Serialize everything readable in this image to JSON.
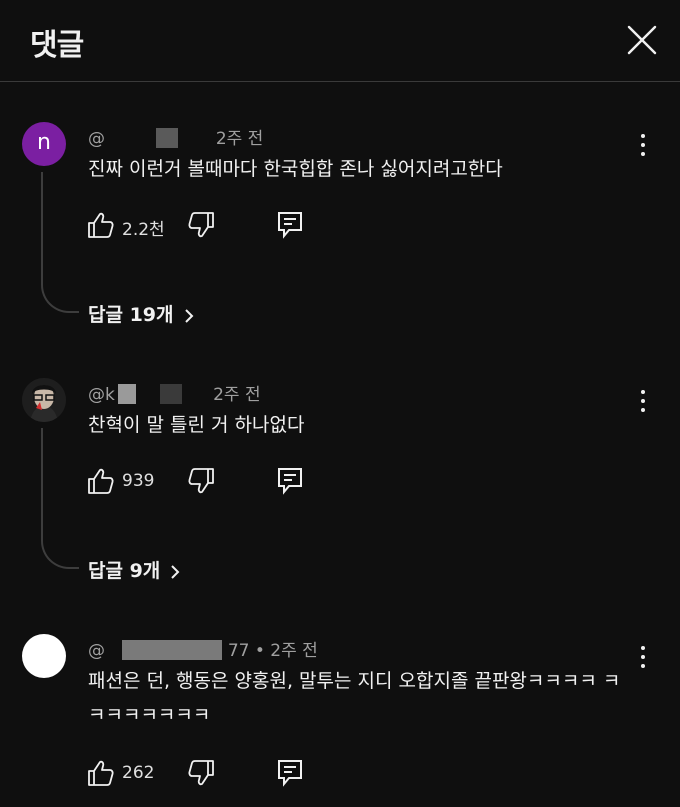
{
  "header": {
    "title": "댓글"
  },
  "comments": [
    {
      "avatar_letter": "n",
      "avatar_color": "#7b1fa2",
      "handle": "@",
      "time": "2주 전",
      "text": "진짜 이런거 볼때마다 한국힙합 존나 싫어지려고한다",
      "likes": "2.2천",
      "replies_label": "답글 19개"
    },
    {
      "handle": "@k",
      "time": "2주 전",
      "text": "찬혁이 말 틀린 거 하나없다",
      "likes": "939",
      "replies_label": "답글 9개"
    },
    {
      "handle": "@",
      "handle_suffix": "77",
      "time": "• 2주 전",
      "text": "패션은 던, 행동은 양홍원, 말투는 지디 오합지졸 끝판왕ㅋㅋㅋㅋ ㅋㅋㅋㅋㅋㅋㅋㅋ",
      "likes": "262"
    }
  ]
}
